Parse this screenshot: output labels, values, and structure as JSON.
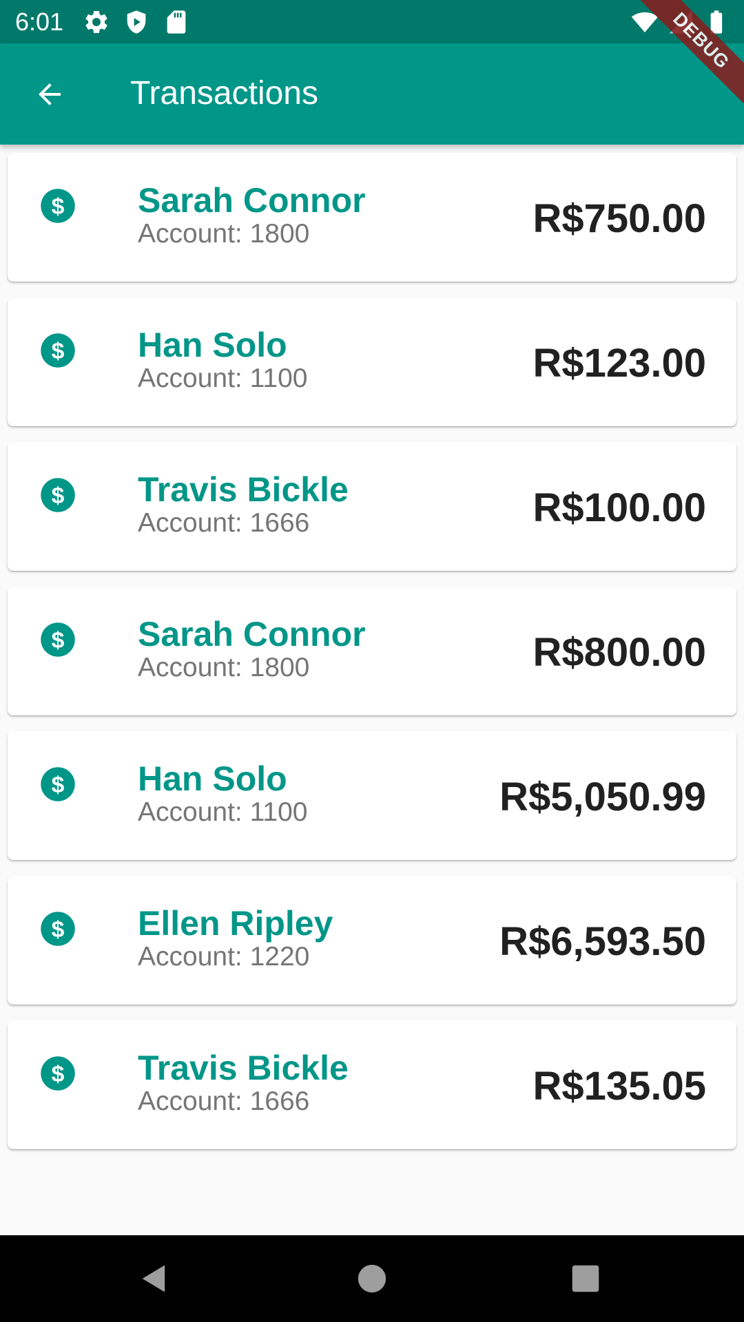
{
  "status_bar": {
    "time": "6:01",
    "left_icons": [
      "settings-icon",
      "play-protect-icon",
      "sd-card-icon"
    ],
    "right_icons": [
      "wifi-icon",
      "signal-icon",
      "battery-icon"
    ]
  },
  "app_bar": {
    "title": "Transactions",
    "back_icon": "arrow-back-icon",
    "color": "#009688",
    "status_color": "#00796b"
  },
  "debug_banner": "DEBUG",
  "transactions": [
    {
      "name": "Sarah Connor",
      "account": "Account: 1800",
      "amount": "R$750.00"
    },
    {
      "name": "Han Solo",
      "account": "Account: 1100",
      "amount": "R$123.00"
    },
    {
      "name": "Travis Bickle",
      "account": "Account: 1666",
      "amount": "R$100.00"
    },
    {
      "name": "Sarah Connor",
      "account": "Account: 1800",
      "amount": "R$800.00"
    },
    {
      "name": "Han Solo",
      "account": "Account: 1100",
      "amount": "R$5,050.99"
    },
    {
      "name": "Ellen Ripley",
      "account": "Account: 1220",
      "amount": "R$6,593.50"
    },
    {
      "name": "Travis Bickle",
      "account": "Account: 1666",
      "amount": "R$135.05"
    }
  ],
  "item_icon": "monetization-on-icon",
  "nav_bar": {
    "icons": [
      "back-triangle-icon",
      "home-circle-icon",
      "recents-square-icon"
    ]
  }
}
